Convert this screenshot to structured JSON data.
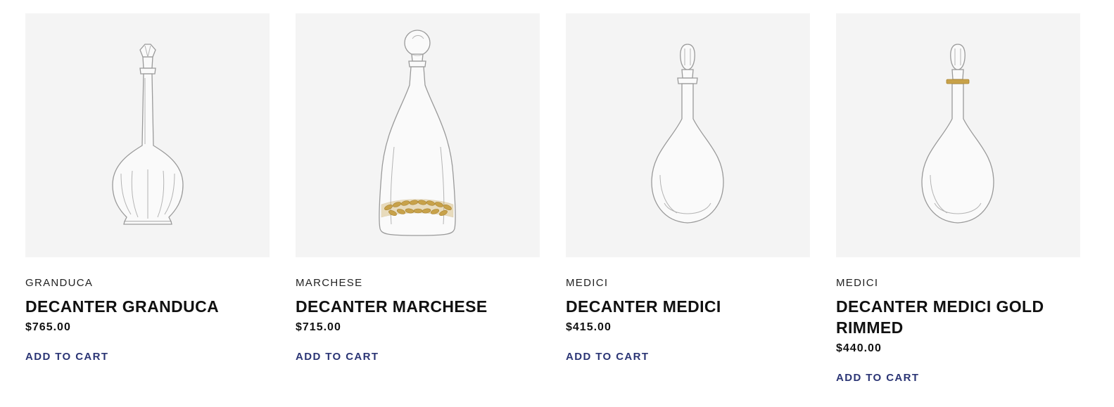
{
  "products": [
    {
      "collection": "GRANDUCA",
      "title": "DECANTER GRANDUCA",
      "price": "$765.00",
      "cta": "ADD TO CART",
      "image_icon": "decanter-granduca-image"
    },
    {
      "collection": "MARCHESE",
      "title": "DECANTER MARCHESE",
      "price": "$715.00",
      "cta": "ADD TO CART",
      "image_icon": "decanter-marchese-image"
    },
    {
      "collection": "MEDICI",
      "title": "DECANTER MEDICI",
      "price": "$415.00",
      "cta": "ADD TO CART",
      "image_icon": "decanter-medici-image"
    },
    {
      "collection": "MEDICI",
      "title": "DECANTER MEDICI GOLD RIMMED",
      "price": "$440.00",
      "cta": "ADD TO CART",
      "image_icon": "decanter-medici-gold-image"
    }
  ],
  "colors": {
    "thumb_bg": "#f4f4f4",
    "cta": "#2b3575",
    "gold": "#c8a24a"
  }
}
